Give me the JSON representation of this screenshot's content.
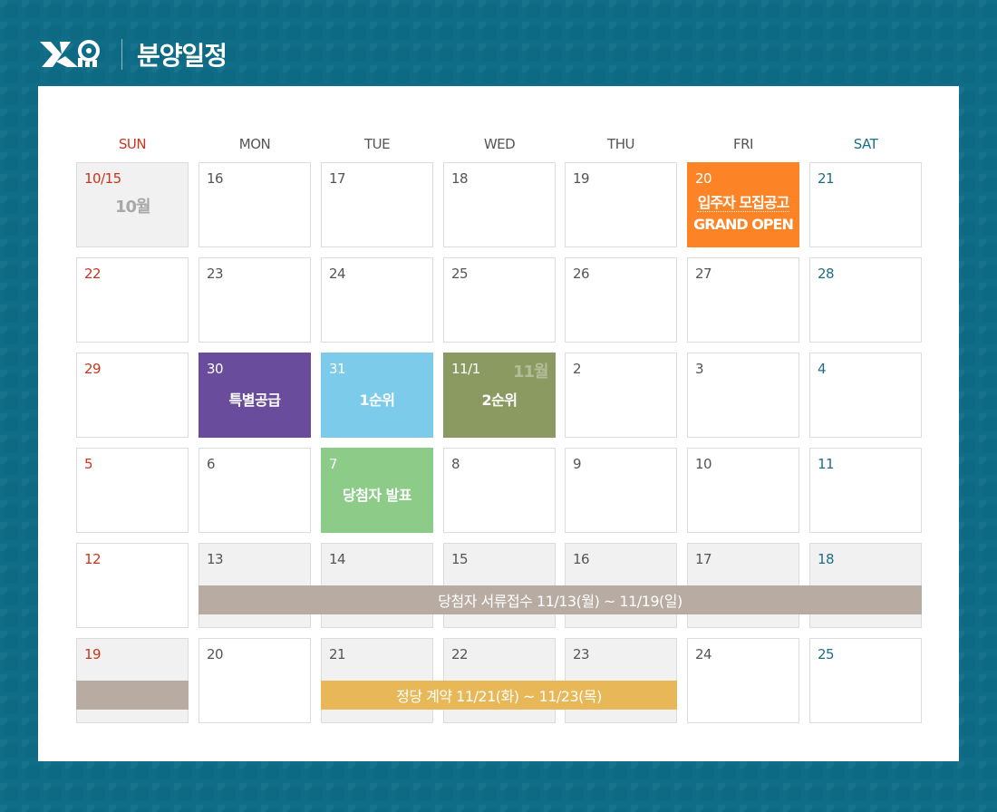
{
  "header": {
    "title": "분양일정",
    "logo_text": "Xi"
  },
  "colors": {
    "background": "#0f6d88",
    "sunday": "#c9351b",
    "saturday": "#1c6e88",
    "announcement": "#fc8427",
    "special_supply": "#6a4c9c",
    "first_rank": "#7ccbea",
    "second_rank": "#8b9a60",
    "winner_announcement": "#8ccb88",
    "document_submission": "#b8aba2",
    "contract": "#e8b858"
  },
  "weekdays": [
    "SUN",
    "MON",
    "TUE",
    "WED",
    "THU",
    "FRI",
    "SAT"
  ],
  "weeks": [
    [
      "10/15",
      "16",
      "17",
      "18",
      "19",
      "20",
      "21"
    ],
    [
      "22",
      "23",
      "24",
      "25",
      "26",
      "27",
      "28"
    ],
    [
      "29",
      "30",
      "31",
      "11/1",
      "2",
      "3",
      "4"
    ],
    [
      "5",
      "6",
      "7",
      "8",
      "9",
      "10",
      "11"
    ],
    [
      "12",
      "13",
      "14",
      "15",
      "16",
      "17",
      "18"
    ],
    [
      "19",
      "20",
      "21",
      "22",
      "23",
      "24",
      "25"
    ]
  ],
  "month_labels": {
    "october": "10월",
    "november": "11월"
  },
  "events": {
    "announcement_line1": "입주자 모집공고",
    "announcement_line2": "GRAND OPEN",
    "special_supply": "특별공급",
    "first_rank": "1순위",
    "second_rank": "2순위",
    "winner_announcement": "당첨자 발표",
    "document_submission": "당첨자 서류접수 11/13(월) ~ 11/19(일)",
    "contract": "정당 계약 11/21(화) ~ 11/23(목)"
  }
}
